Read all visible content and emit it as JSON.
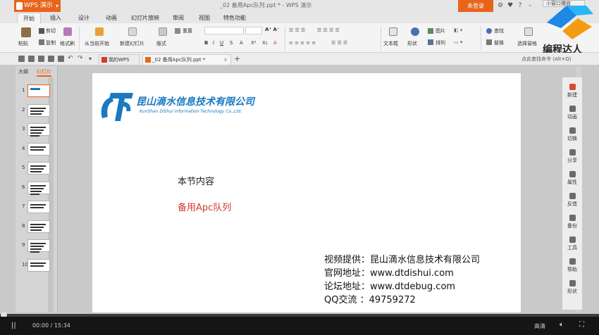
{
  "titlebar": {
    "app_name": "WPS 演示",
    "doc_title": "_02 备用Apc队列.ppt * - WPS 演示",
    "login_label": "未登录",
    "pip_label": "小窗口播放"
  },
  "ribbon_tabs": [
    "开始",
    "插入",
    "设计",
    "动画",
    "幻灯片放映",
    "审阅",
    "视图",
    "特色功能"
  ],
  "ribbon": {
    "paste": "粘贴",
    "cut": "剪切",
    "copy": "复制",
    "format_painter": "格式刷",
    "play_from_current": "从当前开始",
    "new_slide": "新建幻灯片",
    "layout": "版式",
    "reset": "重置",
    "textbox": "文本框",
    "shape": "形状",
    "picture": "图片",
    "arrange": "排列",
    "find": "查找",
    "replace": "替换",
    "select_pane": "选择窗格"
  },
  "brand": {
    "name": "编程达人"
  },
  "quick_access": {
    "tabs": [
      {
        "label": "我的WPS",
        "color": "#d23a2a"
      },
      {
        "label": "_02 备用Apc队列.ppt *",
        "color": "#e8641b"
      }
    ],
    "add_tab": "+",
    "search_hint": "点此查找命令 (Alt+Q)"
  },
  "left_panel": {
    "tabs": [
      "大纲",
      "幻灯片"
    ],
    "slide_numbers": [
      "1",
      "2",
      "3",
      "4",
      "5",
      "6",
      "7",
      "8",
      "9",
      "10"
    ]
  },
  "slide": {
    "company_cn": "昆山滴水信息技术有限公司",
    "company_en": "KunShan DiShui Information Technology Co.,Ltd.",
    "section_title": "本节内容",
    "topic": "备用Apc队列",
    "info_lines": [
      "视频提供：昆山滴水信息技术有限公司",
      "官网地址：www.dtdishui.com",
      "论坛地址：www.dtdebug.com",
      "QQ交流 ：49759272"
    ],
    "colors": {
      "brand_blue": "#1979c2",
      "topic_red": "#d23a2a"
    }
  },
  "right_sidebar": {
    "items": [
      "新建",
      "动画",
      "切换",
      "分享",
      "属性",
      "反馈",
      "备份",
      "工具",
      "帮助",
      "形状"
    ]
  },
  "player": {
    "time": "00:00 / 15:34",
    "quality": "高清",
    "play_icon": "||",
    "volume_icon": "volume-icon",
    "fullscreen_icon": "fullscreen-icon",
    "progress": 0.0
  }
}
